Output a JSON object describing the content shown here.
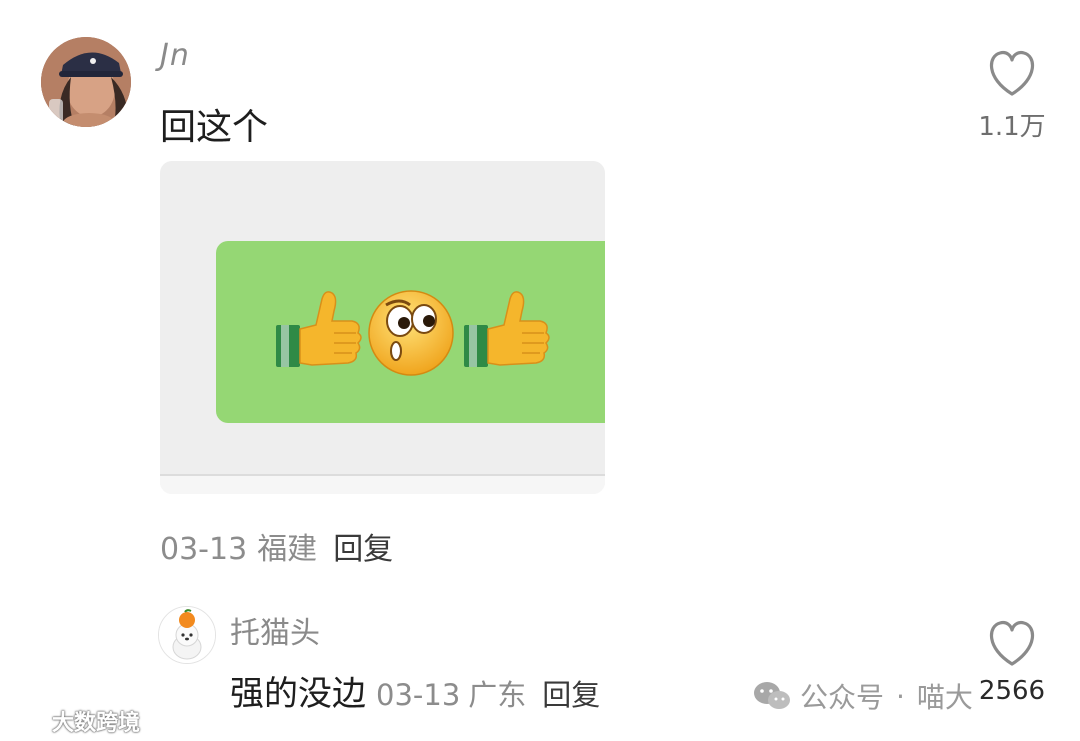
{
  "comment": {
    "username": "Jn",
    "text": "回这个",
    "like_count": "1.1万",
    "date": "03-13",
    "location": "福建",
    "reply_label": "回复",
    "avatar_icon": "user-photo-avatar",
    "like_icon": "heart-outline-icon",
    "sticker": {
      "bubble_color": "#95d774",
      "icons": [
        "thumbs-up-icon",
        "surprised-face-icon",
        "thumbs-up-icon"
      ]
    }
  },
  "reply": {
    "username": "托猫头",
    "text": "强的没边",
    "date": "03-13",
    "location": "广东",
    "reply_label": "回复",
    "like_count": "2566",
    "avatar_icon": "dog-with-orange-avatar",
    "like_icon": "heart-outline-icon"
  },
  "watermarks": {
    "bottom_left": "大数跨境",
    "bottom_right_prefix": "公众号",
    "bottom_right_sep": "·",
    "bottom_right_name": "喵大"
  }
}
